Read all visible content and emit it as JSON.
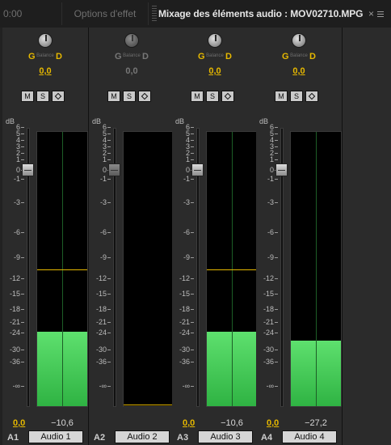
{
  "tabs": {
    "time": "0:00",
    "effect_options": "Options d'effet",
    "mixer": "Mixage des éléments audio : MOV02710.MPG",
    "close": "×"
  },
  "scale": {
    "unit": "dB",
    "ticks": [
      "6",
      "5",
      "4",
      "3",
      "2",
      "1",
      "0",
      "-1",
      "-3",
      "-6",
      "-9",
      "-12",
      "-15",
      "-18",
      "-21",
      "-24",
      "-30",
      "-36",
      "-∞"
    ]
  },
  "pan": {
    "left": "G",
    "center": "Balance",
    "right": "D"
  },
  "buttons": {
    "mute": "M",
    "solo": "S"
  },
  "channels": [
    {
      "id": "A1",
      "name": "Audio 1",
      "pan_value": "0,0",
      "volume": "0,0",
      "peak": "−10,6",
      "meter_level_db": -24,
      "peak_line_db": -10.6,
      "enabled": true
    },
    {
      "id": "A2",
      "name": "Audio 2",
      "pan_value": "0,0",
      "volume": "",
      "peak": "",
      "meter_level_db": null,
      "peak_line_db": null,
      "enabled": false
    },
    {
      "id": "A3",
      "name": "Audio 3",
      "pan_value": "0,0",
      "volume": "0,0",
      "peak": "−10,6",
      "meter_level_db": -24,
      "peak_line_db": -10.6,
      "enabled": true
    },
    {
      "id": "A4",
      "name": "Audio 4",
      "pan_value": "0,0",
      "volume": "0,0",
      "peak": "−27,2",
      "meter_level_db": -27.2,
      "peak_line_db": null,
      "enabled": true
    }
  ],
  "colors": {
    "accent": "#e6b800",
    "meter_green": "#3ec452",
    "background": "#2b2b2b"
  }
}
